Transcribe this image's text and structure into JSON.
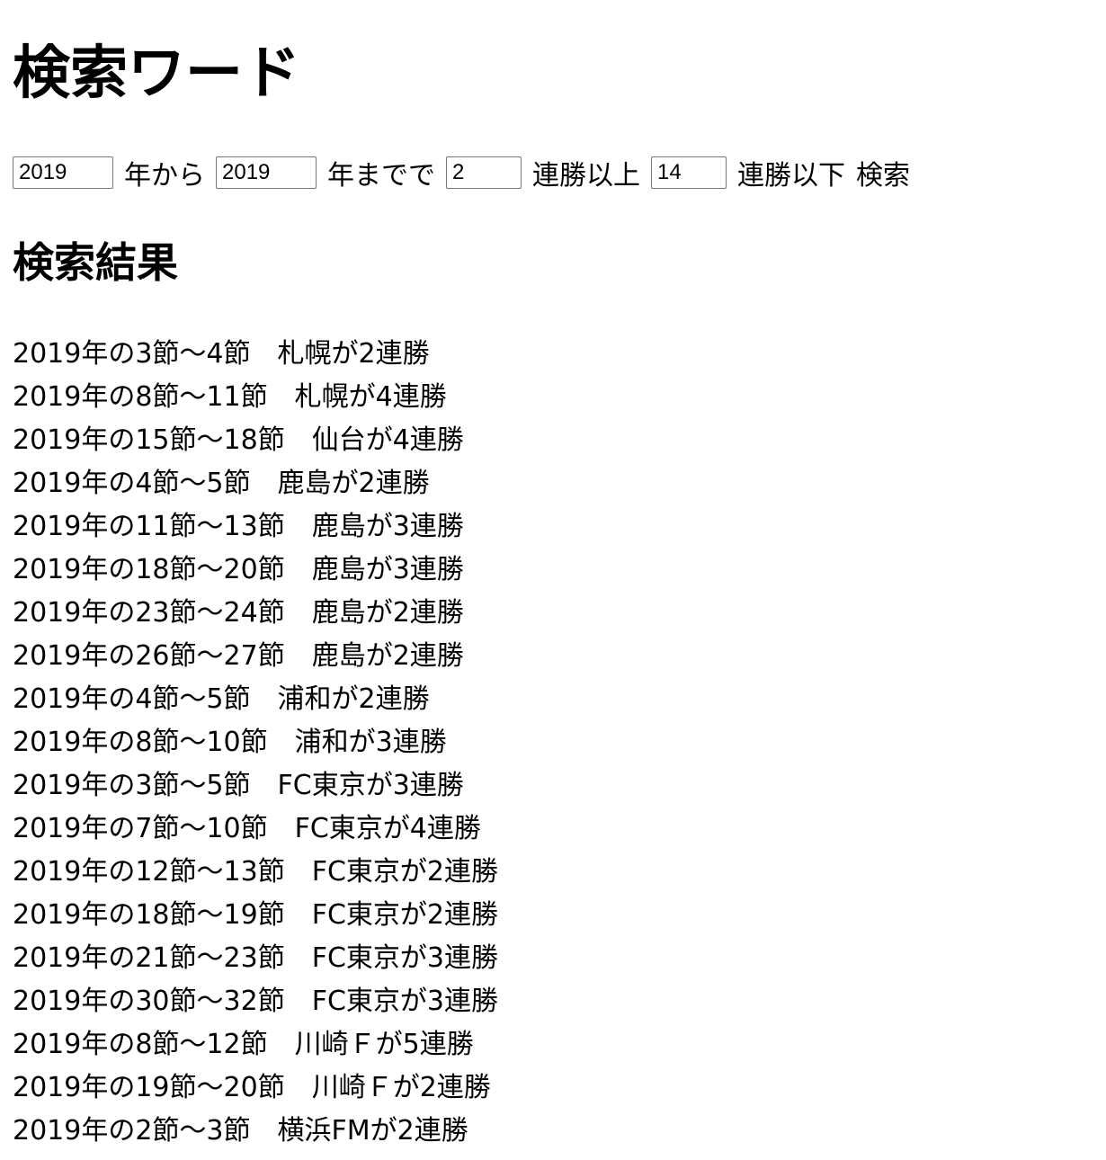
{
  "header": {
    "title": "検索ワード"
  },
  "search": {
    "from_year": "2019",
    "from_suffix": "年から",
    "to_year": "2019",
    "to_suffix": "年までで",
    "min_wins": "2",
    "min_suffix": "連勝以上",
    "max_wins": "14",
    "max_suffix": "連勝以下",
    "submit_label": "検索"
  },
  "results": {
    "title": "検索結果",
    "items": [
      "2019年の3節〜4節　札幌が2連勝",
      "2019年の8節〜11節　札幌が4連勝",
      "2019年の15節〜18節　仙台が4連勝",
      "2019年の4節〜5節　鹿島が2連勝",
      "2019年の11節〜13節　鹿島が3連勝",
      "2019年の18節〜20節　鹿島が3連勝",
      "2019年の23節〜24節　鹿島が2連勝",
      "2019年の26節〜27節　鹿島が2連勝",
      "2019年の4節〜5節　浦和が2連勝",
      "2019年の8節〜10節　浦和が3連勝",
      "2019年の3節〜5節　FC東京が3連勝",
      "2019年の7節〜10節　FC東京が4連勝",
      "2019年の12節〜13節　FC東京が2連勝",
      "2019年の18節〜19節　FC東京が2連勝",
      "2019年の21節〜23節　FC東京が3連勝",
      "2019年の30節〜32節　FC東京が3連勝",
      "2019年の8節〜12節　川崎Ｆが5連勝",
      "2019年の19節〜20節　川崎Ｆが2連勝",
      "2019年の2節〜3節　横浜FMが2連勝"
    ]
  }
}
